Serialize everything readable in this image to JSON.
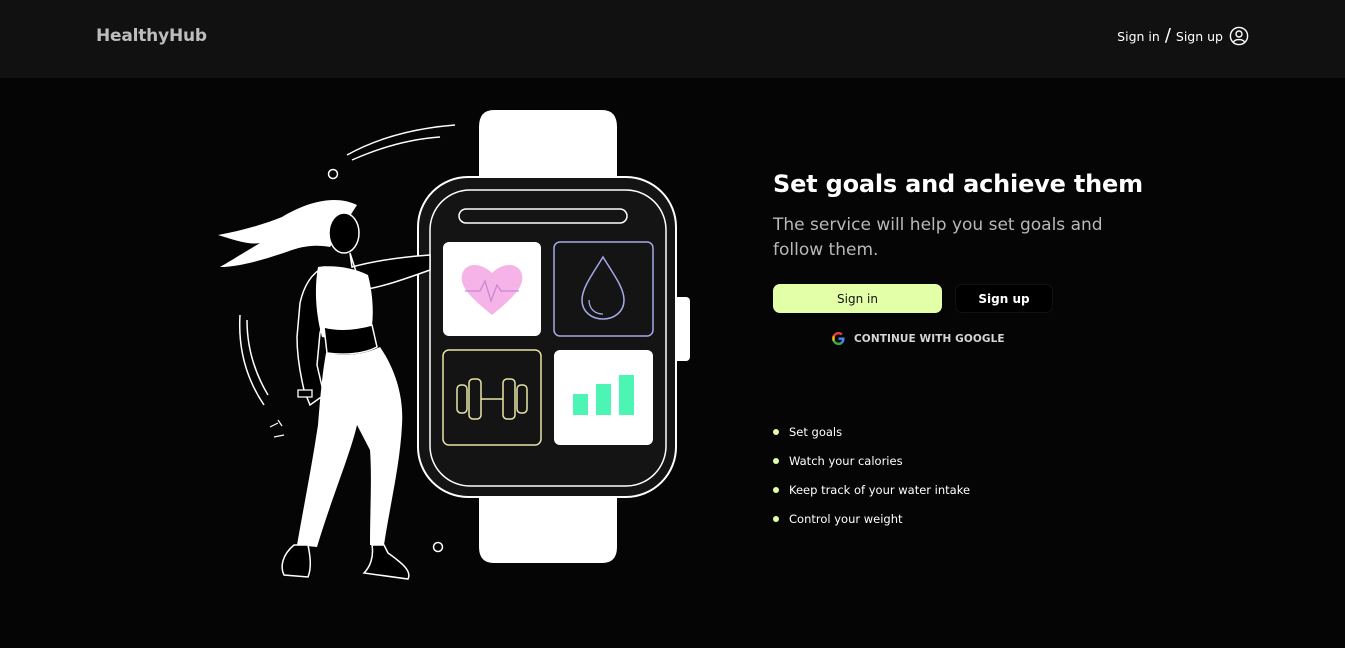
{
  "app": {
    "name": "HealthyHub"
  },
  "header": {
    "signin_label": "Sign in",
    "separator": "/",
    "signup_label": "Sign up"
  },
  "hero": {
    "title": "Set goals and achieve them",
    "subtitle": "The service will help you set goals and follow them.",
    "signin_button": "Sign in",
    "signup_button": "Sign up",
    "google_button": "CONTINUE WITH GOOGLE"
  },
  "features": [
    {
      "label": "Set goals"
    },
    {
      "label": "Watch your calories"
    },
    {
      "label": "Keep track of your water intake"
    },
    {
      "label": "Control your weight"
    }
  ],
  "colors": {
    "accent": "#e3ffa8",
    "background": "#050505",
    "header": "#111111",
    "heart": "#f5b3e8",
    "water": "#a6a9e8",
    "dumbbell": "#e8e3a6",
    "chart": "#4cf5b4"
  },
  "icons": {
    "user": "user-circle-icon",
    "google": "google-icon",
    "heart": "heart-pulse-icon",
    "water": "water-drop-icon",
    "dumbbell": "dumbbell-icon",
    "chart": "bar-chart-icon"
  }
}
